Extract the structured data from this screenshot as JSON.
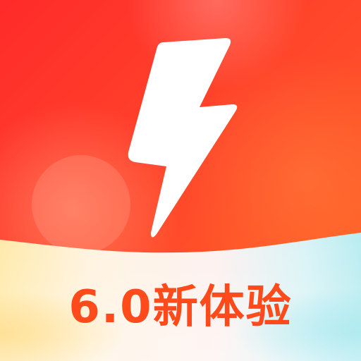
{
  "badge": {
    "text": "6.0新体验"
  },
  "icon": {
    "main": "lightning-bolt-icon"
  },
  "colors": {
    "brand_red": "#ff3b2f",
    "brand_orange": "#ff6a1f",
    "text_orange": "#ff4a1c",
    "bolt_white": "#ffffff"
  }
}
